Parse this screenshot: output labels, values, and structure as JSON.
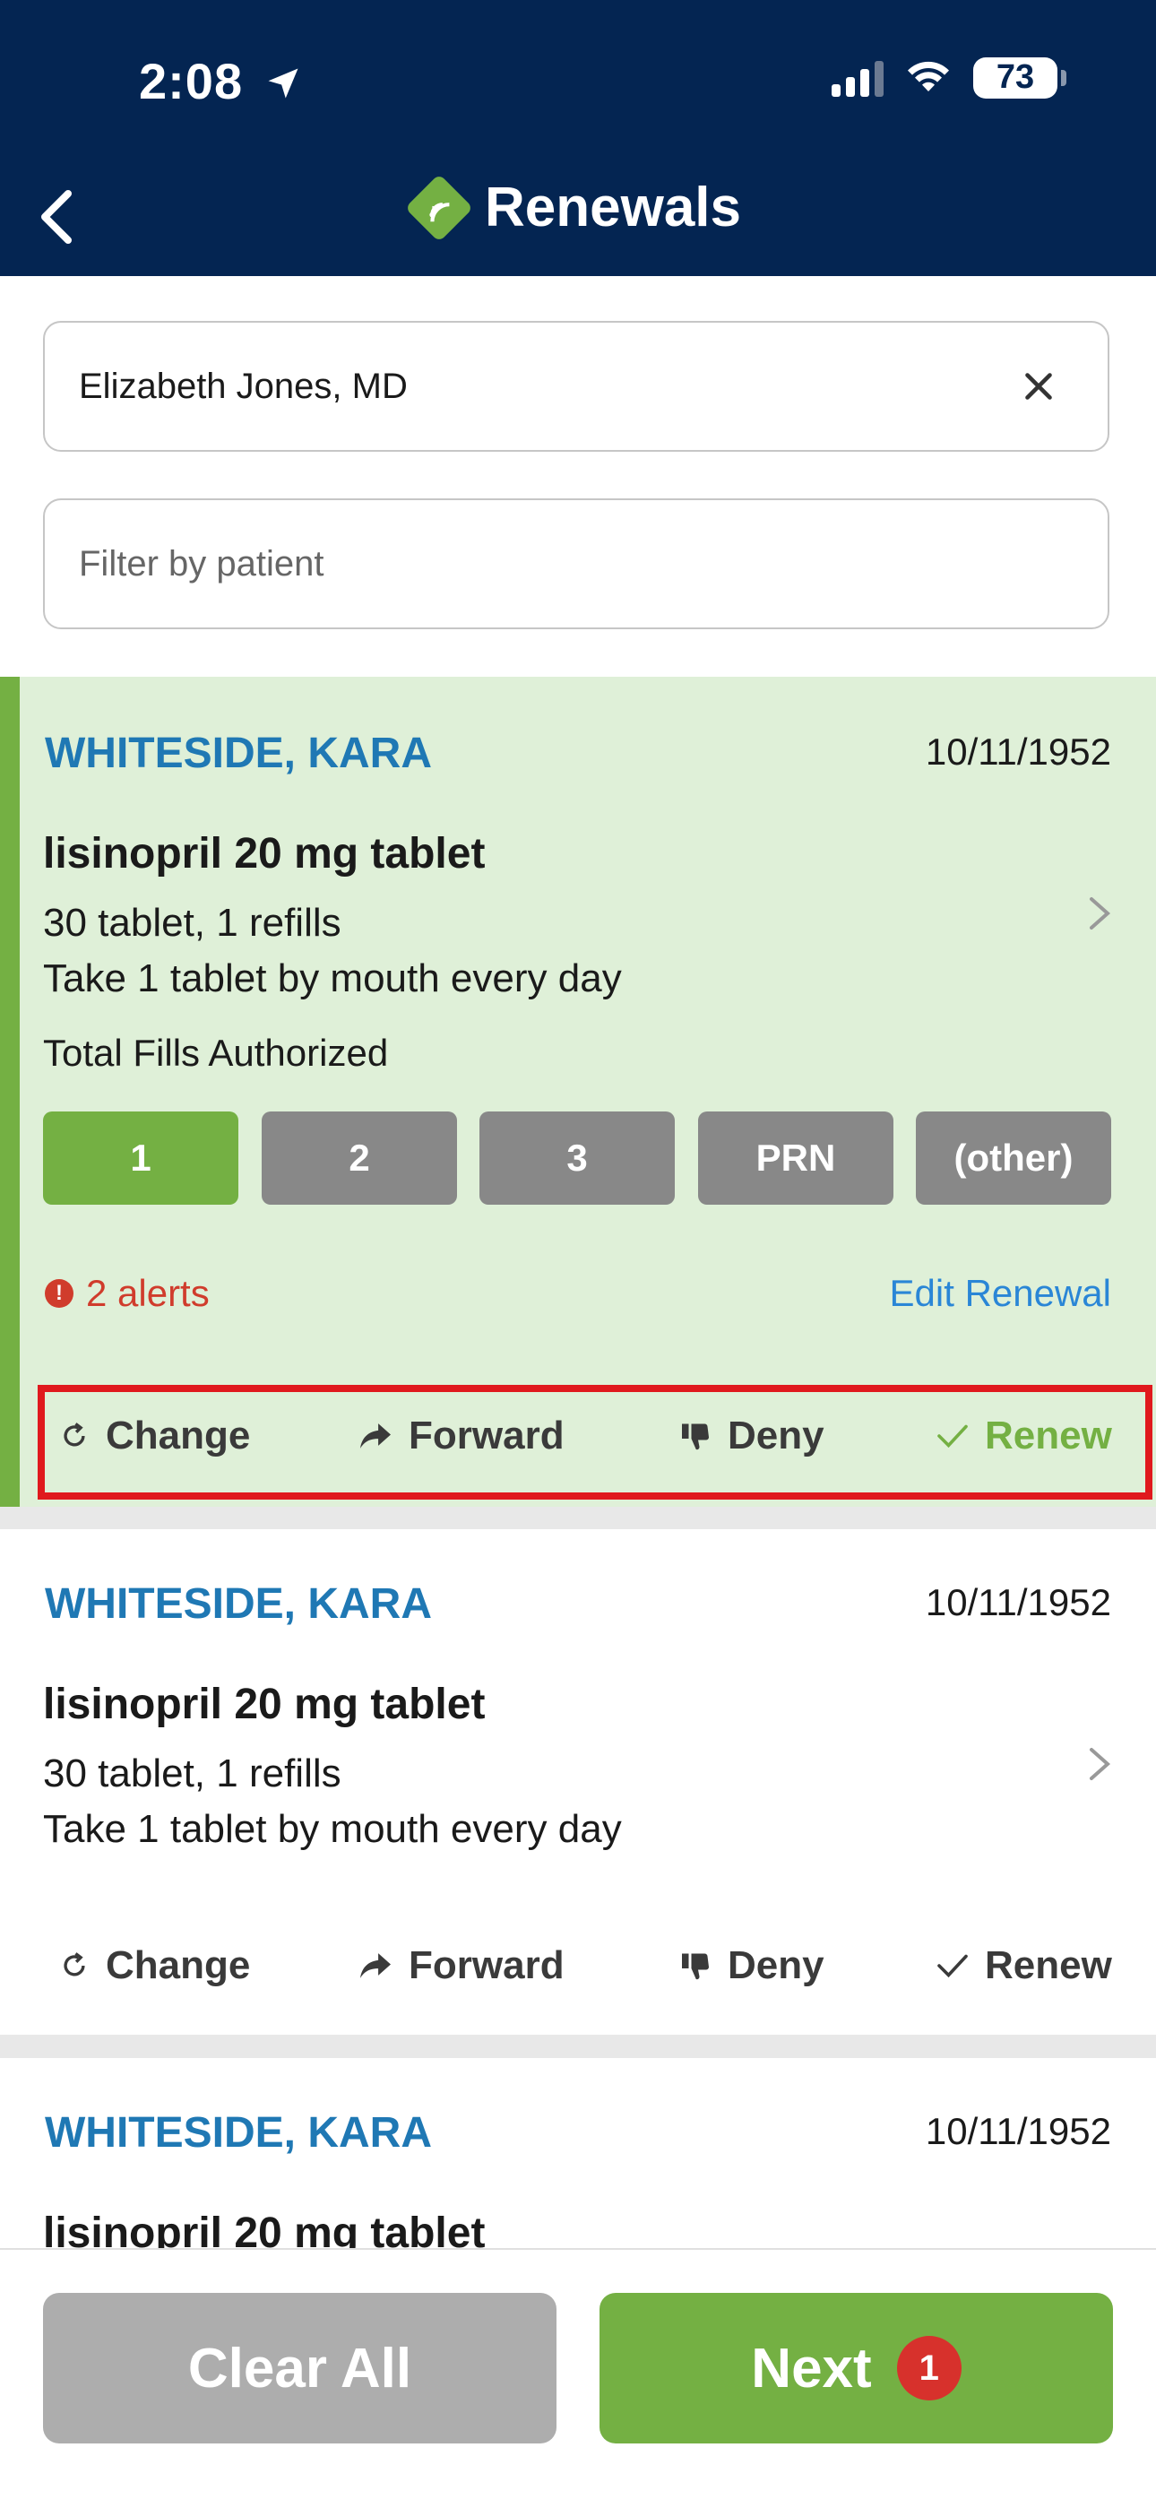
{
  "status_bar": {
    "time": "2:08",
    "battery": "73"
  },
  "header": {
    "title": "Renewals"
  },
  "filters": {
    "provider_value": "Elizabeth Jones, MD",
    "patient_placeholder": "Filter by patient"
  },
  "cards": [
    {
      "patient": "WHITESIDE, KARA",
      "dob": "10/11/1952",
      "drug": "lisinopril 20 mg tablet",
      "qty": "30 tablet, 1 refills",
      "sig": "Take 1 tablet by mouth every day",
      "fills_label": "Total Fills Authorized",
      "fills": [
        "1",
        "2",
        "3",
        "PRN",
        "(other)"
      ],
      "alerts": "2 alerts",
      "edit": "Edit Renewal",
      "actions": {
        "change": "Change",
        "forward": "Forward",
        "deny": "Deny",
        "renew": "Renew"
      }
    },
    {
      "patient": "WHITESIDE, KARA",
      "dob": "10/11/1952",
      "drug": "lisinopril 20 mg tablet",
      "qty": "30 tablet, 1 refills",
      "sig": "Take 1 tablet by mouth every day",
      "actions": {
        "change": "Change",
        "forward": "Forward",
        "deny": "Deny",
        "renew": "Renew"
      }
    },
    {
      "patient": "WHITESIDE, KARA",
      "dob": "10/11/1952",
      "drug": "lisinopril 20 mg tablet"
    }
  ],
  "bottom": {
    "clear_all": "Clear All",
    "next": "Next",
    "next_badge": "1"
  },
  "colors": {
    "header": "#042552",
    "accent_green": "#74b043",
    "link_blue": "#1f78b4",
    "alert_red": "#d03c2c",
    "highlight_box": "#e0191d"
  }
}
